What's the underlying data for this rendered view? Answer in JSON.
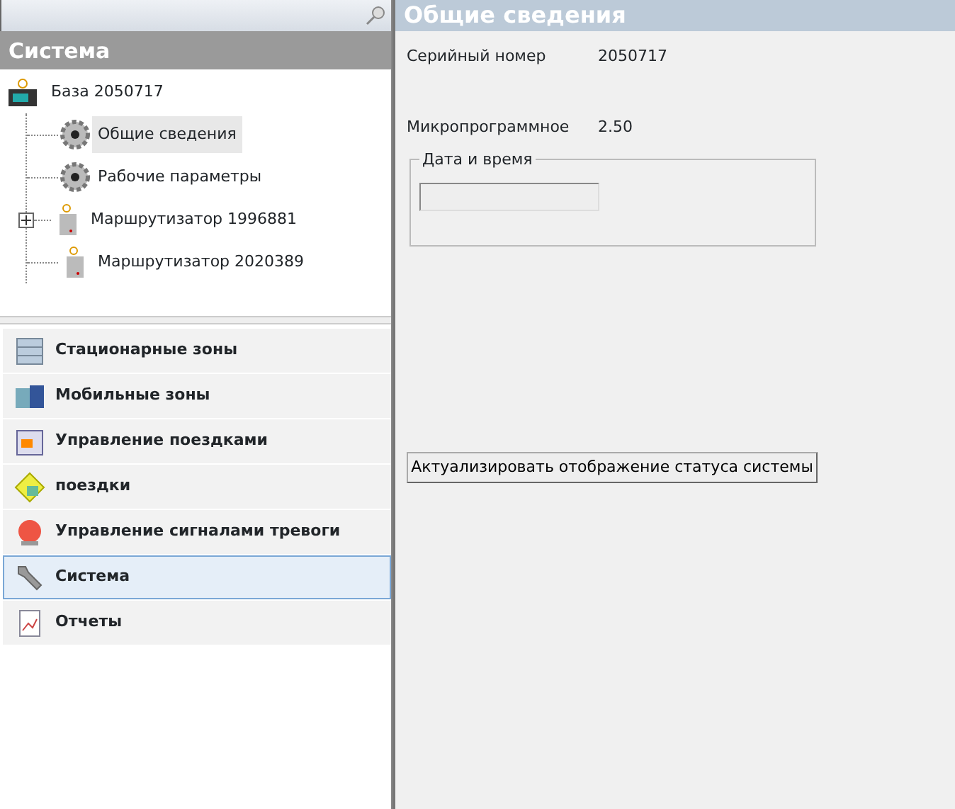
{
  "sidebar": {
    "title": "Система",
    "tree": [
      {
        "label": "База 2050717",
        "kind": "base",
        "selected": false,
        "children": [
          {
            "label": "Общие сведения",
            "kind": "gear",
            "selected": true
          },
          {
            "label": "Рабочие параметры",
            "kind": "gear",
            "selected": false
          },
          {
            "label": "Маршрутизатор 1996881",
            "kind": "router",
            "selected": false,
            "expanded": false
          },
          {
            "label": "Маршрутизатор 2020389",
            "kind": "router",
            "selected": false
          }
        ]
      }
    ],
    "nav_items": [
      {
        "label": "Стационарные зоны",
        "kind": "zones",
        "selected": false
      },
      {
        "label": "Мобильные зоны",
        "kind": "mobile",
        "selected": false
      },
      {
        "label": "Управление поездками",
        "kind": "calendar",
        "selected": false
      },
      {
        "label": "поездки",
        "kind": "trips",
        "selected": false
      },
      {
        "label": "Управление сигналами тревоги",
        "kind": "alarm",
        "selected": false
      },
      {
        "label": "Система",
        "kind": "wrench",
        "selected": true
      },
      {
        "label": "Отчеты",
        "kind": "report",
        "selected": false
      }
    ]
  },
  "content": {
    "title": "Общие сведения",
    "fields": [
      {
        "label": "Серийный номер",
        "value": "2050717"
      },
      {
        "label": "Микропрограммное",
        "value": "2.50"
      }
    ],
    "datetime_group": {
      "legend": "Дата и время"
    },
    "refresh_button": "Актуализировать отображение статуса системы"
  }
}
